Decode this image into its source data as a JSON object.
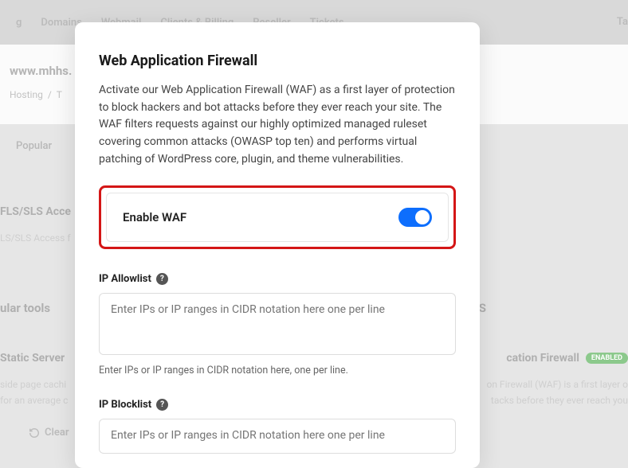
{
  "bg": {
    "nav": [
      "g",
      "Domains",
      "Webmail",
      "Clients & Billing",
      "Reseller",
      "Tickets"
    ],
    "nav_right": "Ta",
    "site_title": "www.mhhs.",
    "breadcrumb": [
      "Hosting",
      "/",
      "T"
    ],
    "tab": "Popular",
    "section_fls": "FLS/SLS Acce",
    "section_fls_sub": "LS/SLS Access f",
    "section_tools": "ular tools",
    "section_static": "Static Server",
    "static_sub1": "side page cachi",
    "static_sub2": "for an average c",
    "clear": "Clear",
    "right_title": "cation Firewall",
    "right_badge": "ENABLED",
    "right_sub1": "on Firewall (WAF) is a first layer o",
    "right_sub2": "tacks before they ever reach you",
    "s_letter": "S"
  },
  "modal": {
    "title": "Web Application Firewall",
    "desc": "Activate our Web Application Firewall (WAF) as a first layer of protection to block hackers and bot attacks before they ever reach your site. The WAF filters requests against our highly optimized managed ruleset covering common attacks (OWASP top ten) and performs virtual patching of WordPress core, plugin, and theme vulnerabilities.",
    "enable_label": "Enable WAF",
    "allowlist": {
      "label": "IP Allowlist",
      "placeholder": "Enter IPs or IP ranges in CIDR notation here one per line",
      "helper": "Enter IPs or IP ranges in CIDR notation here, one per line."
    },
    "blocklist": {
      "label": "IP Blocklist",
      "placeholder": "Enter IPs or IP ranges in CIDR notation here one per line"
    }
  }
}
